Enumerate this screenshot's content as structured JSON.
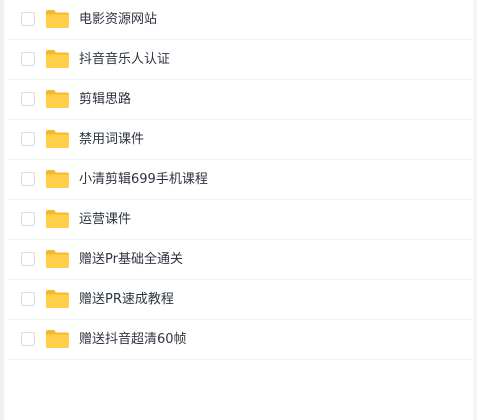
{
  "icon": {
    "folder": "folder-icon",
    "checkbox": "checkbox"
  },
  "colors": {
    "folder_body": "#ffcf4a",
    "folder_tab": "#f5b82e",
    "text": "#2d3440",
    "divider": "#f0f2f5",
    "checkbox_border": "#d7dbe2"
  },
  "files": [
    {
      "name": "电影资源网站"
    },
    {
      "name": "抖音音乐人认证"
    },
    {
      "name": "剪辑思路"
    },
    {
      "name": "禁用词课件"
    },
    {
      "name": "小清剪辑699手机课程"
    },
    {
      "name": "运营课件"
    },
    {
      "name": "赠送Pr基础全通关"
    },
    {
      "name": "赠送PR速成教程"
    },
    {
      "name": "赠送抖音超清60帧"
    }
  ]
}
